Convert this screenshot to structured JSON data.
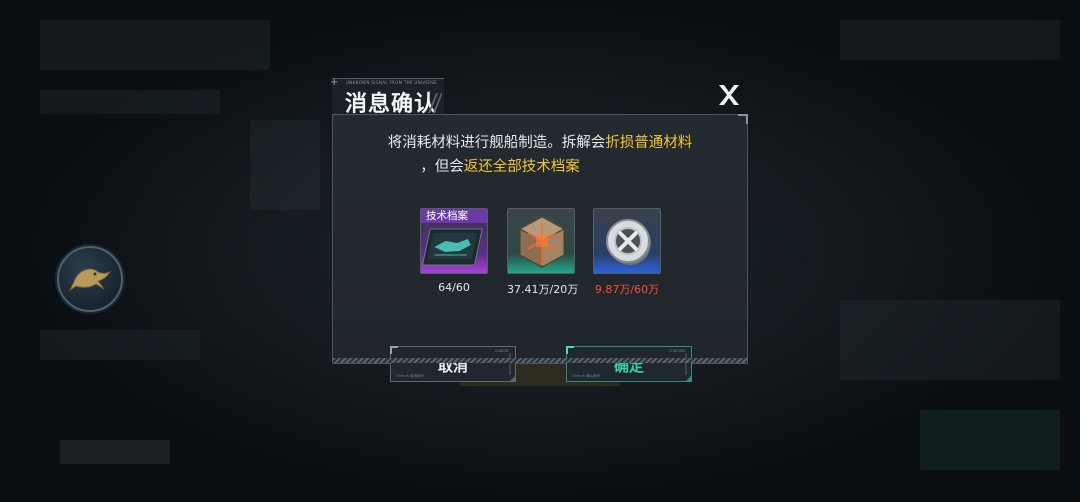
{
  "dialog": {
    "title": "消息确认",
    "subtitle_small": "UNKNOWN SIGNAL FROM THE UNIVERSE",
    "message": {
      "line1_normal": "将消耗材料进行舰船制造。拆解会",
      "line1_highlight": "折损普通材料",
      "line2_normal": "，但会",
      "line2_highlight": "返还全部技术档案"
    },
    "items": [
      {
        "badge": "技术档案",
        "quantity": "64/60",
        "icon": "blueprint-icon",
        "rarity_color": "#a642d8"
      },
      {
        "badge": "",
        "quantity": "37.41万/20万",
        "icon": "alloy-cube-icon",
        "rarity_color": "#21a889"
      },
      {
        "badge": "",
        "quantity": "9.87万/60万",
        "icon": "crystal-coin-icon",
        "rarity_color": "#2d62d8",
        "insufficient": true
      }
    ],
    "buttons": {
      "cancel": {
        "label": "取消",
        "tiny": "7 kfz m 取消指令",
        "tiny_right": "CANCEL"
      },
      "confirm": {
        "label": "确定",
        "tiny": "7 kfz m 确认指令",
        "tiny_right": "CONFIRM"
      }
    }
  },
  "colors": {
    "highlight": "#f5c531",
    "warning": "#ff4a3a",
    "confirm": "#35d2a8"
  }
}
